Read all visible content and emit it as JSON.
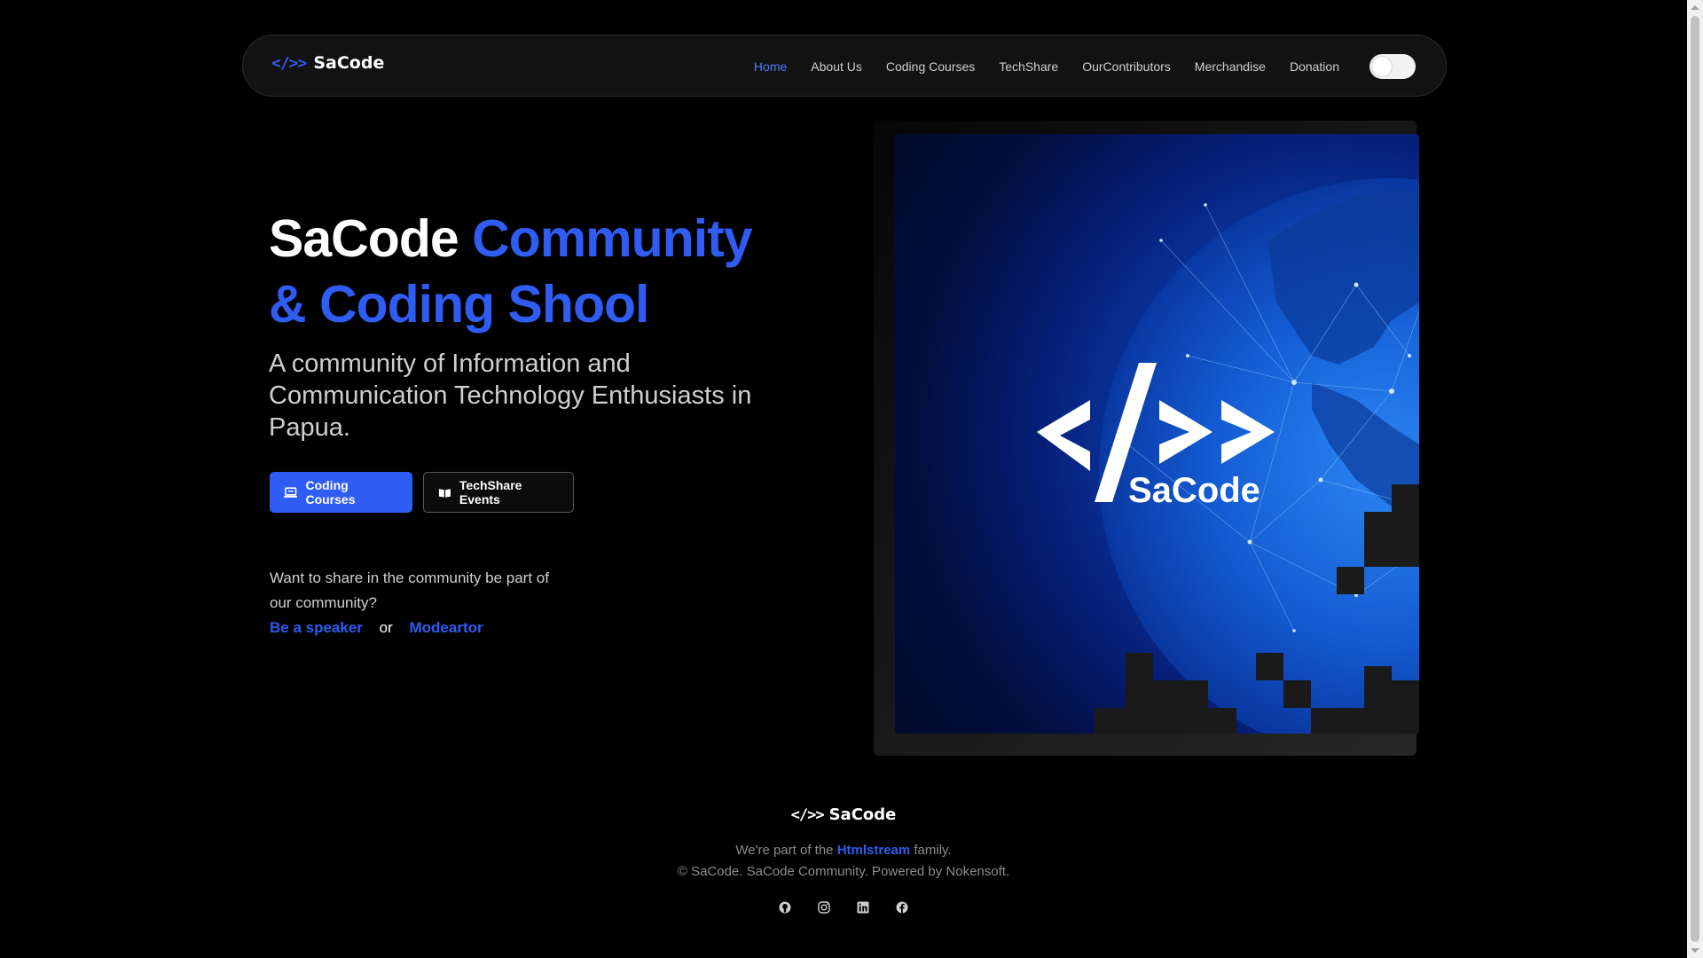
{
  "nav": {
    "brand_glyph": "</>>",
    "brand_name": "SaCode",
    "links": [
      "Home",
      "About Us",
      "Coding Courses",
      "TechShare",
      "OurContributors",
      "Merchandise",
      "Donation"
    ],
    "active": "Home"
  },
  "hero": {
    "title_white": "SaCode",
    "title_blue_1": "Community",
    "title_blue_2": "& Coding Shool",
    "subtitle": "A community of Information and Communication Technology Enthusiasts in Papua.",
    "btn_courses": "Coding Courses",
    "btn_events": "TechShare Events",
    "share_text": "Want to share in the community be part of our community?",
    "speaker_link": "Be a speaker",
    "or_text": "or",
    "moderator_link": "Modeartor"
  },
  "image": {
    "logo_glyph": "</>>",
    "logo_name": "SaCode"
  },
  "footer": {
    "brand_glyph": "</>>",
    "brand_name": "SaCode",
    "line1_prefix": "We're part of the",
    "line1_link": "Htmlstream",
    "line1_suffix": "family.",
    "line2": "© SaCode. SaCode Community. Powered by Nokensoft.",
    "socials": [
      "github-icon",
      "instagram-icon",
      "linkedin-icon",
      "facebook-icon"
    ]
  },
  "colors": {
    "accent": "#2f5cf2",
    "background": "#000000",
    "nav_bg": "#121212"
  }
}
